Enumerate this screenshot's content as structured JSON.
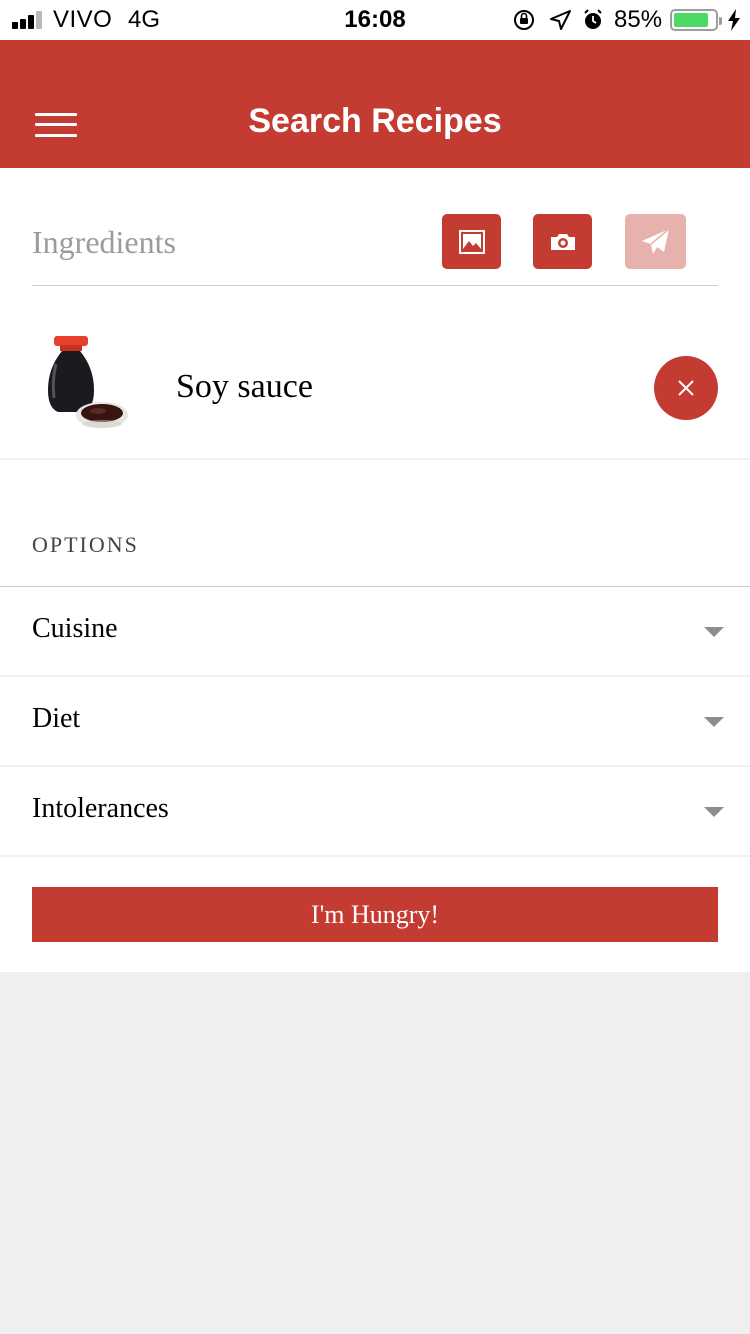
{
  "status_bar": {
    "carrier": "VIVO",
    "network": "4G",
    "time": "16:08",
    "battery_percent_label": "85%",
    "battery_level": 0.85,
    "icons": [
      "signal-icon",
      "orientation-lock-icon",
      "location-arrow-icon",
      "alarm-icon",
      "battery-icon",
      "charging-bolt-icon"
    ]
  },
  "header": {
    "title": "Search Recipes",
    "menu_icon": "hamburger-menu-icon"
  },
  "ingredients": {
    "label": "Ingredients",
    "actions": [
      {
        "name": "gallery",
        "icon": "image-icon"
      },
      {
        "name": "camera",
        "icon": "camera-icon"
      },
      {
        "name": "send",
        "icon": "paper-plane-icon",
        "disabled": true
      }
    ],
    "items": [
      {
        "name": "Soy sauce",
        "image_icon": "soy-sauce-bottle-icon",
        "remove_icon": "close-icon"
      }
    ]
  },
  "options": {
    "title": "OPTIONS",
    "rows": [
      {
        "label": "Cuisine",
        "icon": "caret-down-icon"
      },
      {
        "label": "Diet",
        "icon": "caret-down-icon"
      },
      {
        "label": "Intolerances",
        "icon": "caret-down-icon"
      }
    ]
  },
  "submit_label": "I'm Hungry!",
  "colors": {
    "primary": "#c43b31",
    "primary_disabled": "#e7b1ad",
    "page_background": "#efefef",
    "battery_green": "#4cd964"
  }
}
